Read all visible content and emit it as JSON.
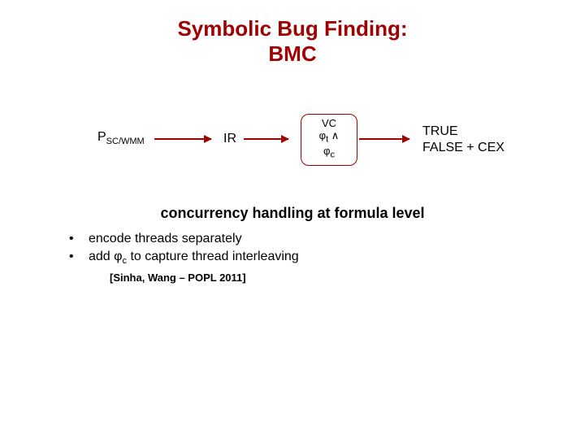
{
  "title_line1": "Symbolic Bug Finding:",
  "title_line2": "BMC",
  "diagram": {
    "p_label": "P",
    "p_sub": "SC/WMM",
    "ir_label": "IR",
    "vc_title": "VC",
    "vc_line1a": "φ",
    "vc_line1a_sub": "t",
    "vc_line1b": " ∧",
    "vc_line2": "φ",
    "vc_line2_sub": "c",
    "out_line1": "TRUE",
    "out_line2": "FALSE + CEX"
  },
  "caption": "concurrency handling at formula level",
  "bullets": {
    "b1": "encode threads separately",
    "b2_pre": "add φ",
    "b2_sub": "c",
    "b2_post": " to capture thread interleaving"
  },
  "citation": "[Sinha, Wang – POPL 2011]"
}
